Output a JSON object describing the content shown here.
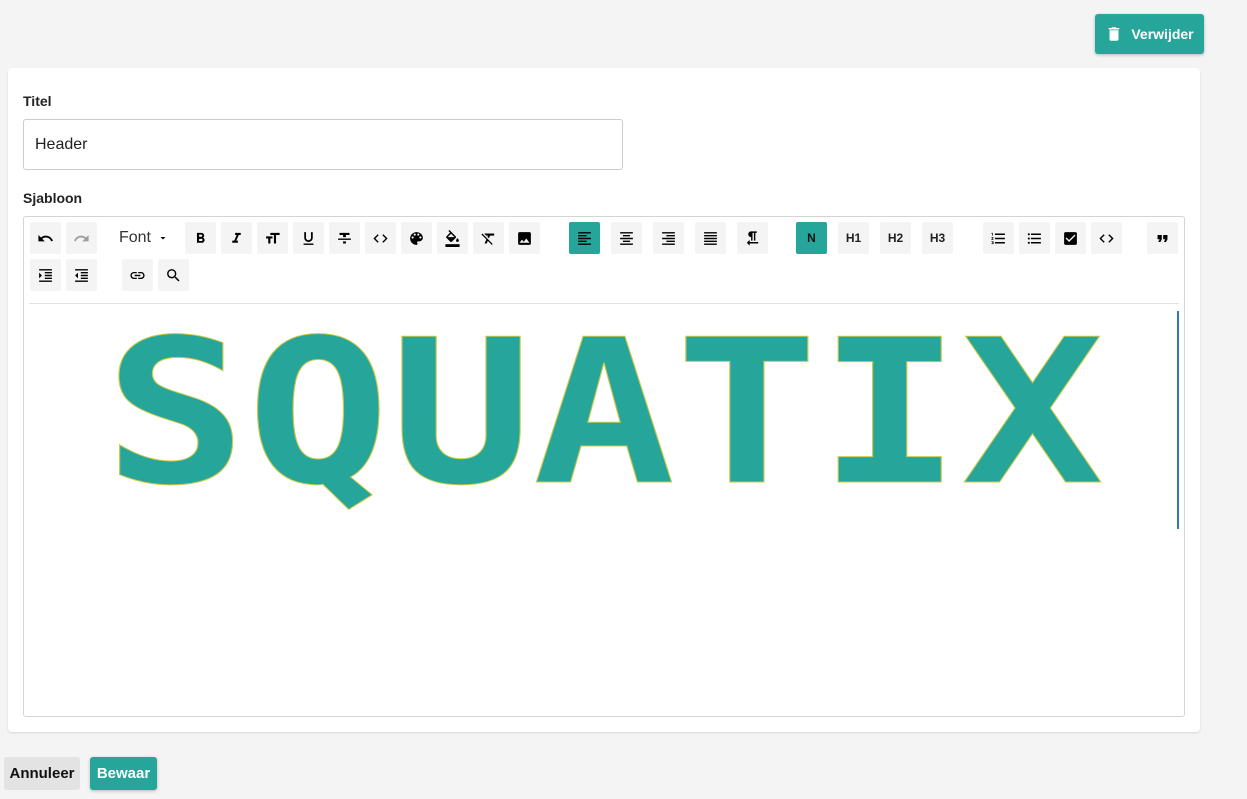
{
  "header": {
    "delete_label": "Verwijder"
  },
  "form": {
    "title_label": "Titel",
    "title_value": "Header",
    "template_label": "Sjabloon"
  },
  "toolbar": {
    "font_label": "Font",
    "normal_label": "N",
    "h1_label": "H1",
    "h2_label": "H2",
    "h3_label": "H3"
  },
  "editor_content": {
    "logo_text": "SQUATIX"
  },
  "footer": {
    "cancel_label": "Annuleer",
    "save_label": "Bewaar"
  },
  "colors": {
    "accent": "#26a69a",
    "background": "#f4f4f4"
  }
}
